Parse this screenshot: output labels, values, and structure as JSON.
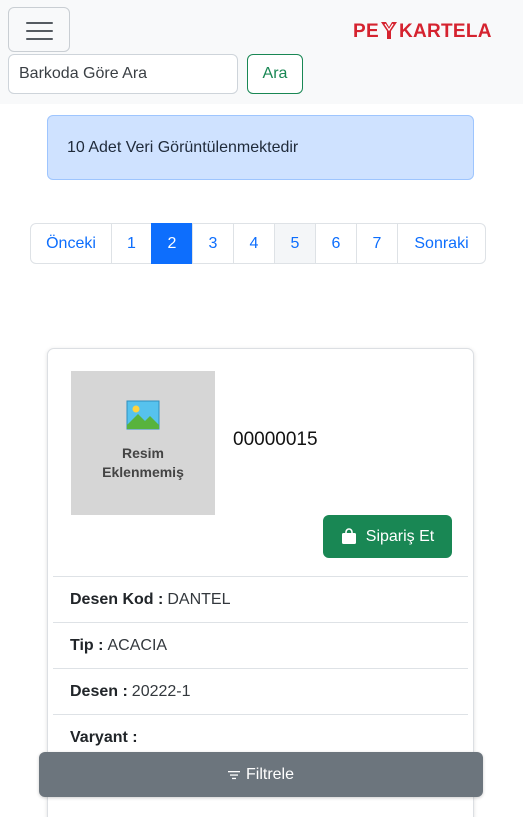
{
  "navbar": {
    "brand": {
      "part1": "PE",
      "part2": "KARTELA",
      "color": "#d5232f"
    },
    "search": {
      "placeholder": "Barkoda Göre Ara",
      "value": "",
      "button_label": "Ara"
    }
  },
  "alert": {
    "text": "10 Adet Veri Görüntülenmektedir",
    "color": "#cfe2ff"
  },
  "pagination": {
    "previous": "Önceki",
    "pages": [
      "1",
      "2",
      "3",
      "4",
      "5",
      "6",
      "7"
    ],
    "active_page": "2",
    "next": "Sonraki"
  },
  "product": {
    "image_placeholder": "Resim Eklenmemiş",
    "barcode": "00000015",
    "order_button": "Sipariş Et",
    "details": [
      {
        "label": "Desen Kod :",
        "value": "DANTEL"
      },
      {
        "label": "Tip :",
        "value": "ACACIA"
      },
      {
        "label": "Desen :",
        "value": "20222-1"
      },
      {
        "label": "Varyant :",
        "value": ""
      }
    ]
  },
  "filter_button": {
    "label": "Filtrele",
    "icon": "filter-icon"
  },
  "colors": {
    "primary": "#0d6efd",
    "success": "#198754",
    "secondary": "#6c757d"
  }
}
